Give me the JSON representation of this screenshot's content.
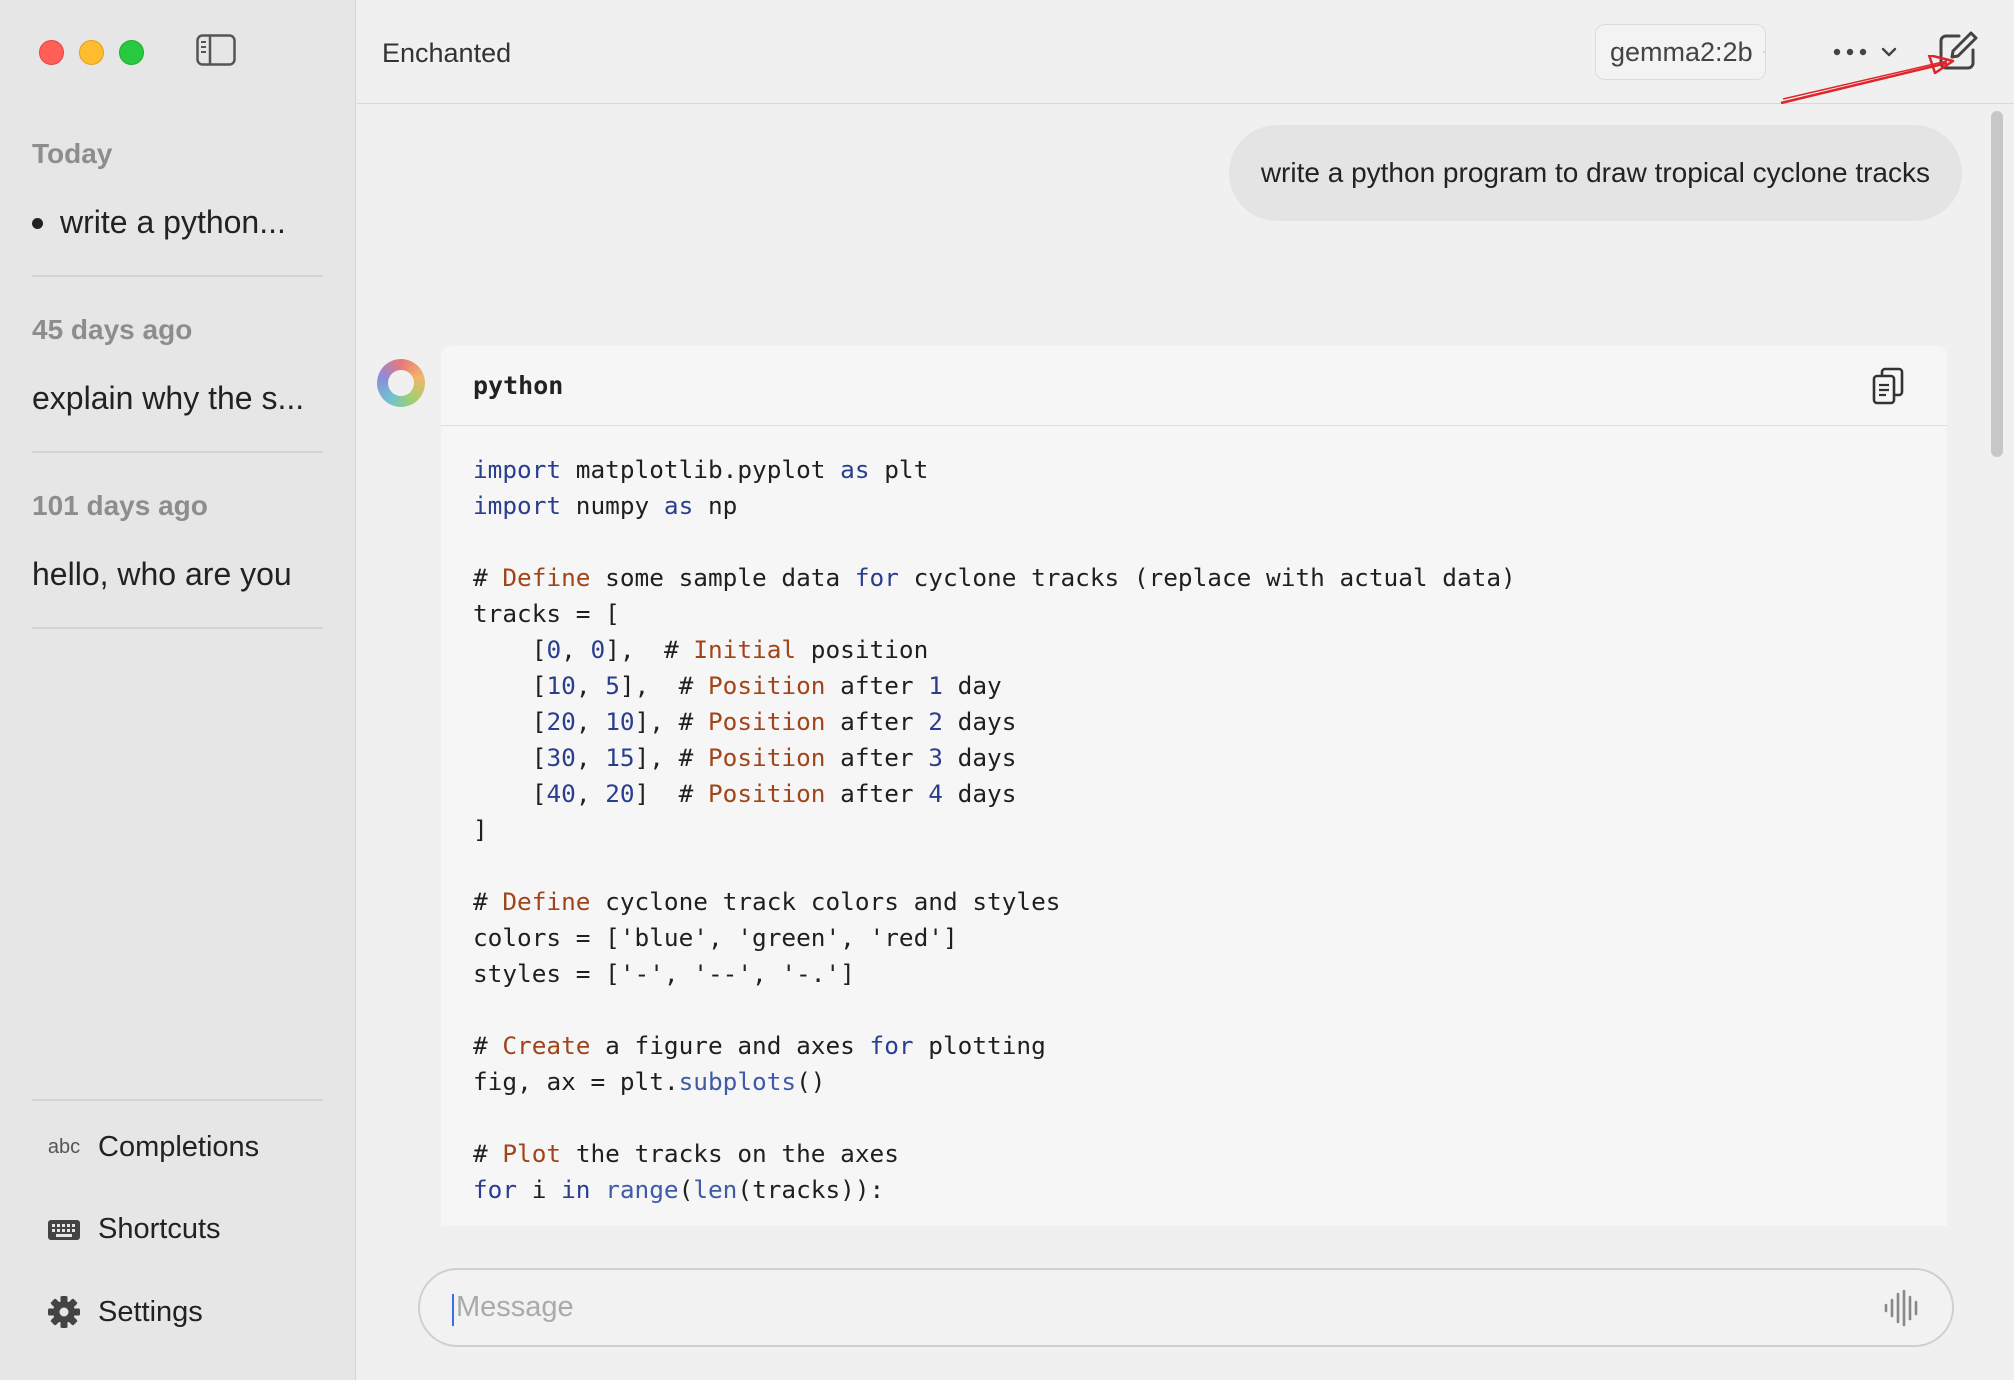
{
  "window": {
    "title": "Enchanted"
  },
  "sidebar": {
    "groups": [
      {
        "heading": "Today",
        "items": [
          {
            "label": "write a python..."
          }
        ]
      },
      {
        "heading": "45 days ago",
        "items": [
          {
            "label": "explain why the s..."
          }
        ]
      },
      {
        "heading": "101 days ago",
        "items": [
          {
            "label": "hello, who are you"
          }
        ]
      }
    ],
    "bottom_menu": [
      {
        "label": "Completions",
        "icon": "abc-text-icon",
        "icon_text": "abc"
      },
      {
        "label": "Shortcuts",
        "icon": "keyboard-icon"
      },
      {
        "label": "Settings",
        "icon": "gear-icon"
      }
    ]
  },
  "toolbar": {
    "model": "gemma2:2b"
  },
  "chat": {
    "user_message": "write a python program to draw tropical cyclone tracks",
    "code_block": {
      "language": "python",
      "lines": [
        "import matplotlib.pyplot as plt",
        "import numpy as np",
        "",
        "# Define some sample data for cyclone tracks (replace with actual data)",
        "tracks = [",
        "    [0, 0],  # Initial position",
        "    [10, 5],  # Position after 1 day",
        "    [20, 10], # Position after 2 days",
        "    [30, 15], # Position after 3 days",
        "    [40, 20]  # Position after 4 days",
        "]",
        "",
        "# Define cyclone track colors and styles",
        "colors = ['blue', 'green', 'red']",
        "styles = ['-', '--', '-.']",
        "",
        "# Create a figure and axes for plotting",
        "fig, ax = plt.subplots()",
        "",
        "# Plot the tracks on the axes",
        "for i in range(len(tracks)):"
      ]
    }
  },
  "composer": {
    "placeholder": "Message"
  },
  "colors": {
    "close": "#ff5f57",
    "minimize": "#febc2e",
    "zoom": "#28c840",
    "annotation_arrow": "#e0242a",
    "code_keyword": "#2a3e8e",
    "code_comment_word": "#a0451a"
  }
}
